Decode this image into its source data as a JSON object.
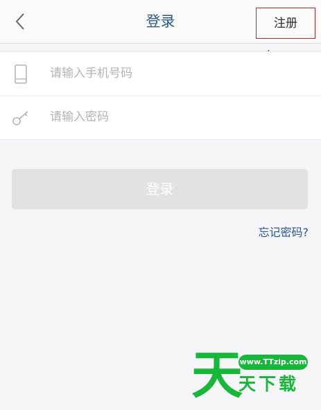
{
  "header": {
    "title": "登录",
    "register_label": "注册"
  },
  "form": {
    "phone_placeholder": "请输入手机号码",
    "password_placeholder": "请输入密码"
  },
  "actions": {
    "login_label": "登录",
    "forgot_label": "忘记密码?"
  },
  "watermark": {
    "big_text": "天",
    "url_text": "www.TTzip.com",
    "sub_text": "天下载"
  },
  "icons": {
    "back": "chevron-left-icon",
    "phone": "phone-icon",
    "key": "key-icon"
  },
  "colors": {
    "title_blue": "#2b5a8a",
    "annotation_red": "#b3272a",
    "login_disabled": "#e2e2e4",
    "watermark_green": "#17b839"
  }
}
